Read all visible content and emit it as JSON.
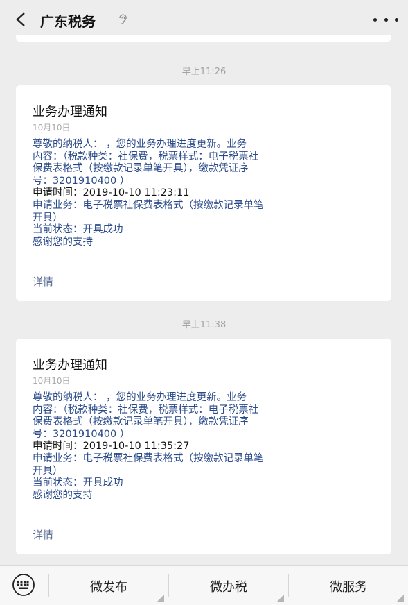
{
  "header": {
    "title": "广东税务"
  },
  "messages": [
    {
      "time": "早上11:26",
      "title": "业务办理通知",
      "date": "10月10日",
      "lines": [
        "尊敬的纳税人：        ，您的业务办理进度更新。业务",
        "内容：（税款种类：社保费，税票样式：电子税票社",
        "保费表格式（按缴款记录单笔开具），缴款凭证序",
        "号：3201910400              ）"
      ],
      "apply_time": "申请时间：2019-10-10 11:23:11",
      "business_1": "申请业务：电子税票社保费表格式（按缴款记录单笔",
      "business_2": "开具）",
      "status": "当前状态：开具成功",
      "thanks": "感谢您的支持",
      "link": "详情"
    },
    {
      "time": "早上11:38",
      "title": "业务办理通知",
      "date": "10月10日",
      "lines": [
        "尊敬的纳税人：        ，您的业务办理进度更新。业务",
        "内容：（税款种类：社保费，税票样式：电子税票社",
        "保费表格式（按缴款记录单笔开具），缴款凭证序",
        "号：3201910400              ）"
      ],
      "apply_time": "申请时间：2019-10-10 11:35:27",
      "business_1": "申请业务：电子税票社保费表格式（按缴款记录单笔",
      "business_2": "开具）",
      "status": "当前状态：开具成功",
      "thanks": "感谢您的支持",
      "link": "详情"
    }
  ],
  "bottom_menu": [
    "微发布",
    "微办税",
    "微服务"
  ],
  "icons": [
    "back-icon",
    "ear-icon",
    "more-icon",
    "keyboard-icon"
  ]
}
